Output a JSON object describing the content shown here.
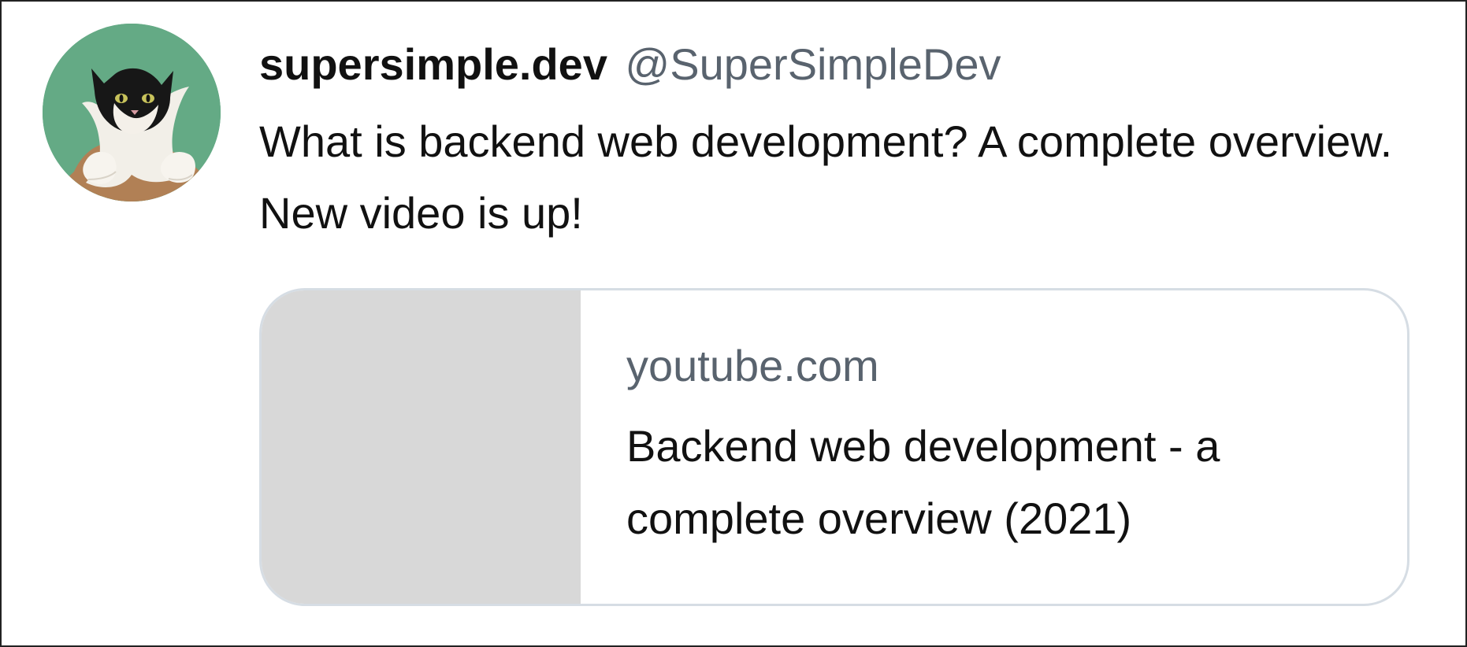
{
  "tweet": {
    "author": {
      "name": "supersimple.dev",
      "handle": "@SuperSimpleDev",
      "avatar_icon": "cat-avatar-photo"
    },
    "text": "What is backend web development? A complete overview. New video is up!",
    "link_card": {
      "domain": "youtube.com",
      "title": "Backend web development - a complete overview (2021)"
    }
  },
  "colors": {
    "text": "#111111",
    "secondary_text": "#59636e",
    "card_border": "#d6dde4",
    "thumbnail_placeholder": "#d8d8d8",
    "avatar_background": "#5fa880"
  }
}
